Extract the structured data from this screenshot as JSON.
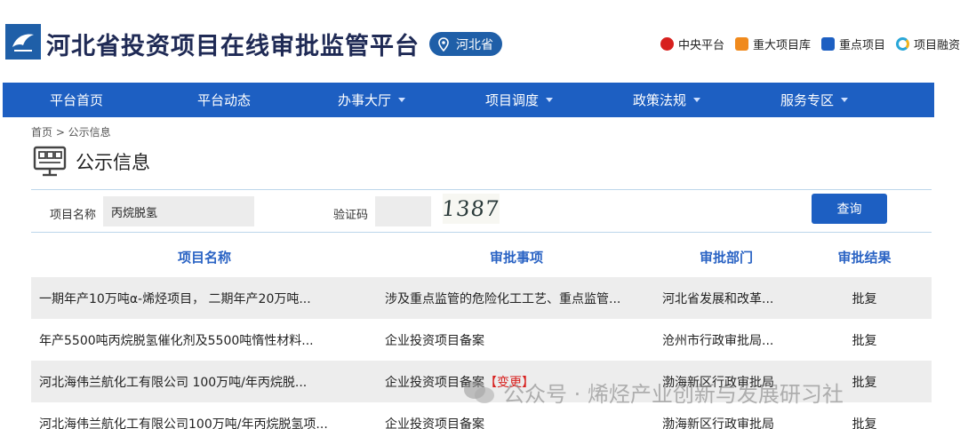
{
  "header": {
    "site_title": "河北省投资项目在线审批监管平台",
    "region": "河北省",
    "top_links": [
      {
        "label": "中央平台",
        "icon": "emblem-icon",
        "color": "#d7201e"
      },
      {
        "label": "重大项目库",
        "icon": "cube-icon",
        "color": "#f08a1d"
      },
      {
        "label": "重点项目",
        "icon": "book-icon",
        "color": "#1d5fc2"
      },
      {
        "label": "项目融资",
        "icon": "ring-icon",
        "color": "#2aa7d8"
      }
    ]
  },
  "nav": {
    "items": [
      {
        "label": "平台首页",
        "has_dropdown": false
      },
      {
        "label": "平台动态",
        "has_dropdown": false
      },
      {
        "label": "办事大厅",
        "has_dropdown": true
      },
      {
        "label": "项目调度",
        "has_dropdown": true
      },
      {
        "label": "政策法规",
        "has_dropdown": true
      },
      {
        "label": "服务专区",
        "has_dropdown": true
      }
    ]
  },
  "breadcrumb": "首页 > 公示信息",
  "page_title": "公示信息",
  "search": {
    "project_name_label": "项目名称",
    "project_name_value": "丙烷脱氢",
    "captcha_label": "验证码",
    "captcha_value": "",
    "captcha_image_text": "1387",
    "query_label": "查询"
  },
  "table": {
    "headers": [
      "项目名称",
      "审批事项",
      "审批部门",
      "审批结果"
    ],
    "rows": [
      {
        "name": "一期年产10万吨α-烯烃项目， 二期年产20万吨...",
        "matter": "涉及重点监管的危险化工工艺、重点监管...",
        "matter_tag": "",
        "dept": "河北省发展和改革...",
        "result": "批复"
      },
      {
        "name": "年产5500吨丙烷脱氢催化剂及5500吨惰性材料...",
        "matter": "企业投资项目备案",
        "matter_tag": "",
        "dept": "沧州市行政审批局...",
        "result": "批复"
      },
      {
        "name": "河北海伟兰航化工有限公司 100万吨/年丙烷脱...",
        "matter": "企业投资项目备案",
        "matter_tag": "【变更】",
        "dept": "渤海新区行政审批局",
        "result": "批复"
      },
      {
        "name": "河北海伟兰航化工有限公司100万吨/年丙烷脱氢项...",
        "matter": "企业投资项目备案",
        "matter_tag": "",
        "dept": "渤海新区行政审批局",
        "result": "批复"
      }
    ]
  },
  "watermark": "公众号 · 烯烃产业创新与发展研习社"
}
